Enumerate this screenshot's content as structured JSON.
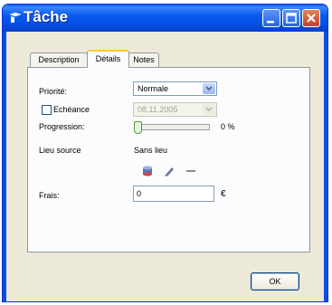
{
  "window": {
    "title": "Tâche"
  },
  "tabs": [
    "Description",
    "Détails",
    "Notes"
  ],
  "active_tab": "Détails",
  "details": {
    "priority_label": "Priorité:",
    "priority_value": "Normale",
    "due_label": "Echéance",
    "due_value": "08.11.2005",
    "due_checked": false,
    "progress_label": "Progression:",
    "progress_value": "0 %",
    "progress_fraction": 0,
    "source_label": "Lieu source",
    "source_value": "Sans lieu",
    "cost_label": "Frais:",
    "cost_value": "0",
    "currency": "€"
  },
  "buttons": {
    "ok": "OK"
  },
  "icons": [
    "database-icon",
    "pen-icon",
    "dash-icon"
  ]
}
